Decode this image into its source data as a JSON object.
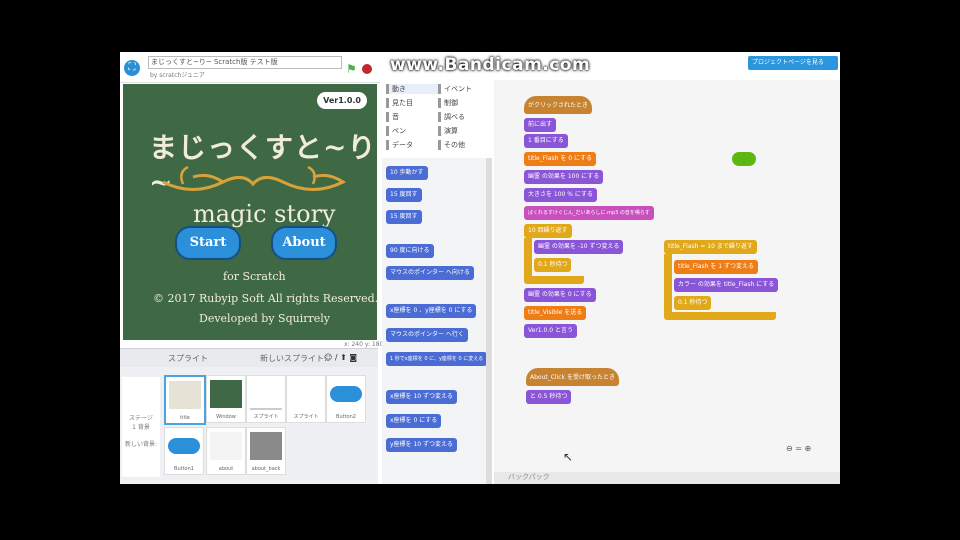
{
  "watermark": "www.Bandicam.com",
  "header": {
    "project_title": "まじっくすと~り~ Scratch版 テスト版",
    "author": "by scratchジュニア",
    "share_label": "プロジェクトページを見る"
  },
  "stage": {
    "version": "Ver1.0.0",
    "title_ja": "まじっくすと~り~",
    "title_en": "magic story",
    "start_label": "Start",
    "about_label": "About",
    "credit1": "for Scratch",
    "credit2": "© 2017 Rubyip Soft All rights Reserved.",
    "credit3": "Developed by Squirrely",
    "bg_color": "#3f6845"
  },
  "sprites": {
    "header_label": "スプライト",
    "new_label": "新しいスプライト:",
    "stage_label": "ステージ",
    "stage_sub": "1 背景",
    "new_bg": "新しい背景:",
    "items": [
      {
        "label": "title",
        "selected": true
      },
      {
        "label": "Window",
        "selected": false
      },
      {
        "label": "スプライト",
        "selected": false
      },
      {
        "label": "スプライト",
        "selected": false
      },
      {
        "label": "Button2",
        "selected": false
      },
      {
        "label": "Button1",
        "selected": false
      },
      {
        "label": "about",
        "selected": false
      },
      {
        "label": "about_back",
        "selected": false
      }
    ]
  },
  "categories": [
    {
      "label": "動き",
      "color": "#4a6cd4"
    },
    {
      "label": "イベント",
      "color": "#c88330"
    },
    {
      "label": "見た目",
      "color": "#8a55d7"
    },
    {
      "label": "制御",
      "color": "#e1a91a"
    },
    {
      "label": "音",
      "color": "#c94fbf"
    },
    {
      "label": "調べる",
      "color": "#2ca5e2"
    },
    {
      "label": "ペン",
      "color": "#0e9a6c"
    },
    {
      "label": "演算",
      "color": "#5cb712"
    },
    {
      "label": "データ",
      "color": "#ee7d16"
    },
    {
      "label": "その他",
      "color": "#632d99"
    }
  ],
  "palette": [
    "10 歩動かす",
    "15 度回す",
    "15 度回す",
    "90 度に向ける",
    "マウスのポインター へ向ける",
    "x座標を 0 、y座標を 0 にする",
    "マウスのポインター へ行く",
    "1 秒でx座標を 0 に、y座標を 0 に変える",
    "x座標を 10 ずつ変える",
    "x座標を 0 にする",
    "y座標を 10 ずつ変える"
  ],
  "script1": [
    "がクリックされたとき",
    "前に出す",
    "1 番目にする",
    "title_Flash を 0 にする",
    "幽霊 の効果を 100 にする",
    "大きさを 100 % にする",
    "ばくれるすけぐじん_だいあらしに.mp3 の音を鳴らす",
    "10 回繰り返す",
    "幽霊 の効果を -10 ずつ変える",
    "0.1 秒待つ",
    "幽霊 の効果を 0 にする",
    "title_Visible を送る",
    "Ver1.0.0 と言う"
  ],
  "script2": [
    "title_Flash = 10 まで繰り返す",
    "title_Flash を 1 ずつ変える",
    "カラー の効果を title_Flash にする",
    "0.1 秒待つ"
  ],
  "script3": [
    "About_Click を受け取ったとき",
    "と 0.5 秒待つ"
  ],
  "floating_reporter": "",
  "bottom_label": "バックパック",
  "zoom_label": "⊖ = ⊕",
  "stage_tools": "x: 240 y: 180"
}
